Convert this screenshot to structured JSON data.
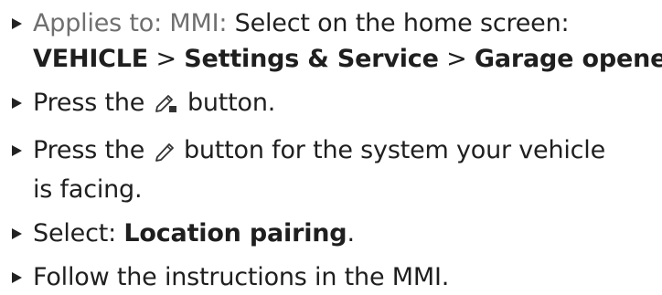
{
  "steps": [
    {
      "prefix": "Applies to: MMI:",
      "text": "Select on the home screen:",
      "path": {
        "item1": "VEHICLE",
        "sep1": ">",
        "item2": "Settings & Service",
        "sep2": ">",
        "item3": "Garage opener",
        "end": "."
      }
    },
    {
      "before": "Press the",
      "icon": "pencil-square-icon",
      "after": "button."
    },
    {
      "before": "Press the",
      "icon": "pencil-icon",
      "after_line1": "button for the system your vehicle",
      "after_line2": "is facing."
    },
    {
      "before": "Select:",
      "bold": "Location pairing",
      "end": "."
    },
    {
      "text": "Follow the instructions in the MMI."
    }
  ]
}
